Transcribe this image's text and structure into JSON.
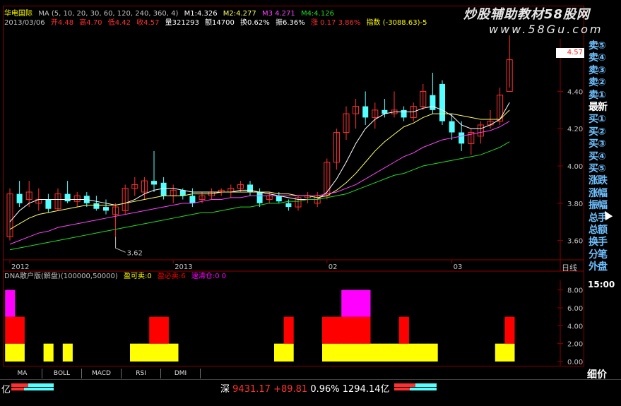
{
  "header": {
    "stock_name": "华电国际",
    "ma_label": "MA (5, 10, 20, 30, 60, 120, 240, 360, 4)",
    "m1": "M1:4.326",
    "m2": "M2:4.277",
    "m3": "M3 4.271",
    "m4": "M4:4.126",
    "date": "2013/03/06",
    "open": "开4.48",
    "high": "高4.70",
    "low": "低4.42",
    "close": "收4.57",
    "volume": "量321293",
    "amount": "额14700",
    "turnover": "换0.62%",
    "amplitude": "振6.36%",
    "change": "涨 0.17 3.86%",
    "index": "指数 (-3088.63)-5"
  },
  "watermark": {
    "line1": "炒股辅助教材58股网",
    "line2": "www.58Gu.com"
  },
  "chart_data": [
    {
      "type": "candlestick",
      "ylim": [
        3.5,
        4.72
      ],
      "y_ticks": [
        3.6,
        3.8,
        4.0,
        4.2,
        4.4
      ],
      "y_tick_labels": [
        "3.60",
        "3.80",
        "4.00",
        "4.20",
        "4.40"
      ],
      "x_tick_labels": [
        "2012",
        "2013",
        "02",
        "03"
      ],
      "x_tick_index": [
        0,
        17,
        33,
        46
      ],
      "grid": false,
      "current_price_label": "4.57",
      "low_annotation": {
        "label": "3.62",
        "index": 11,
        "value": 3.62
      },
      "candles": [
        {
          "o": 3.62,
          "h": 3.88,
          "l": 3.6,
          "c": 3.85
        },
        {
          "o": 3.85,
          "h": 3.92,
          "l": 3.78,
          "c": 3.8
        },
        {
          "o": 3.82,
          "h": 3.92,
          "l": 3.78,
          "c": 3.86
        },
        {
          "o": 3.8,
          "h": 3.88,
          "l": 3.76,
          "c": 3.82
        },
        {
          "o": 3.82,
          "h": 3.85,
          "l": 3.75,
          "c": 3.77
        },
        {
          "o": 3.77,
          "h": 3.88,
          "l": 3.76,
          "c": 3.85
        },
        {
          "o": 3.85,
          "h": 3.92,
          "l": 3.8,
          "c": 3.81
        },
        {
          "o": 3.81,
          "h": 3.86,
          "l": 3.78,
          "c": 3.84
        },
        {
          "o": 3.84,
          "h": 3.86,
          "l": 3.78,
          "c": 3.8
        },
        {
          "o": 3.8,
          "h": 3.84,
          "l": 3.76,
          "c": 3.77
        },
        {
          "o": 3.78,
          "h": 3.82,
          "l": 3.74,
          "c": 3.76
        },
        {
          "o": 3.74,
          "h": 3.8,
          "l": 3.62,
          "c": 3.78
        },
        {
          "o": 3.76,
          "h": 3.9,
          "l": 3.74,
          "c": 3.88
        },
        {
          "o": 3.88,
          "h": 3.94,
          "l": 3.84,
          "c": 3.9
        },
        {
          "o": 3.86,
          "h": 3.94,
          "l": 3.82,
          "c": 3.92
        },
        {
          "o": 3.92,
          "h": 4.08,
          "l": 3.86,
          "c": 3.9
        },
        {
          "o": 3.91,
          "h": 3.94,
          "l": 3.82,
          "c": 3.84
        },
        {
          "o": 3.84,
          "h": 3.9,
          "l": 3.8,
          "c": 3.87
        },
        {
          "o": 3.87,
          "h": 3.88,
          "l": 3.82,
          "c": 3.84
        },
        {
          "o": 3.84,
          "h": 3.88,
          "l": 3.78,
          "c": 3.8
        },
        {
          "o": 3.82,
          "h": 3.86,
          "l": 3.8,
          "c": 3.84
        },
        {
          "o": 3.84,
          "h": 3.88,
          "l": 3.82,
          "c": 3.86
        },
        {
          "o": 3.86,
          "h": 3.88,
          "l": 3.84,
          "c": 3.87
        },
        {
          "o": 3.86,
          "h": 3.9,
          "l": 3.83,
          "c": 3.88
        },
        {
          "o": 3.88,
          "h": 3.92,
          "l": 3.86,
          "c": 3.9
        },
        {
          "o": 3.9,
          "h": 3.92,
          "l": 3.84,
          "c": 3.86
        },
        {
          "o": 3.86,
          "h": 3.88,
          "l": 3.78,
          "c": 3.8
        },
        {
          "o": 3.82,
          "h": 3.86,
          "l": 3.8,
          "c": 3.84
        },
        {
          "o": 3.84,
          "h": 3.86,
          "l": 3.8,
          "c": 3.81
        },
        {
          "o": 3.8,
          "h": 3.82,
          "l": 3.76,
          "c": 3.78
        },
        {
          "o": 3.78,
          "h": 3.84,
          "l": 3.76,
          "c": 3.83
        },
        {
          "o": 3.83,
          "h": 3.86,
          "l": 3.8,
          "c": 3.84
        },
        {
          "o": 3.8,
          "h": 3.86,
          "l": 3.78,
          "c": 3.84
        },
        {
          "o": 3.84,
          "h": 4.04,
          "l": 3.82,
          "c": 4.02
        },
        {
          "o": 4.02,
          "h": 4.2,
          "l": 3.98,
          "c": 4.18
        },
        {
          "o": 4.18,
          "h": 4.32,
          "l": 4.14,
          "c": 4.28
        },
        {
          "o": 4.28,
          "h": 4.36,
          "l": 4.2,
          "c": 4.32
        },
        {
          "o": 4.32,
          "h": 4.4,
          "l": 4.22,
          "c": 4.26
        },
        {
          "o": 4.26,
          "h": 4.34,
          "l": 4.2,
          "c": 4.3
        },
        {
          "o": 4.3,
          "h": 4.36,
          "l": 4.26,
          "c": 4.28
        },
        {
          "o": 4.28,
          "h": 4.4,
          "l": 4.26,
          "c": 4.3
        },
        {
          "o": 4.3,
          "h": 4.32,
          "l": 4.24,
          "c": 4.26
        },
        {
          "o": 4.26,
          "h": 4.34,
          "l": 4.24,
          "c": 4.32
        },
        {
          "o": 4.32,
          "h": 4.44,
          "l": 4.3,
          "c": 4.4
        },
        {
          "o": 4.38,
          "h": 4.5,
          "l": 4.28,
          "c": 4.3
        },
        {
          "o": 4.44,
          "h": 4.46,
          "l": 4.22,
          "c": 4.24
        },
        {
          "o": 4.24,
          "h": 4.28,
          "l": 4.14,
          "c": 4.18
        },
        {
          "o": 4.18,
          "h": 4.24,
          "l": 4.08,
          "c": 4.12
        },
        {
          "o": 4.12,
          "h": 4.2,
          "l": 4.06,
          "c": 4.18
        },
        {
          "o": 4.16,
          "h": 4.24,
          "l": 4.12,
          "c": 4.22
        },
        {
          "o": 4.22,
          "h": 4.3,
          "l": 4.2,
          "c": 4.24
        },
        {
          "o": 4.24,
          "h": 4.42,
          "l": 4.22,
          "c": 4.38
        },
        {
          "o": 4.4,
          "h": 4.7,
          "l": 4.42,
          "c": 4.57
        }
      ],
      "ma_lines": [
        {
          "color": "#ffffff",
          "values": [
            3.7,
            3.76,
            3.8,
            3.82,
            3.82,
            3.82,
            3.82,
            3.82,
            3.82,
            3.81,
            3.8,
            3.79,
            3.8,
            3.82,
            3.85,
            3.87,
            3.88,
            3.88,
            3.87,
            3.86,
            3.86,
            3.86,
            3.86,
            3.86,
            3.87,
            3.87,
            3.86,
            3.85,
            3.84,
            3.83,
            3.82,
            3.82,
            3.82,
            3.86,
            3.93,
            4.02,
            4.12,
            4.2,
            4.25,
            4.28,
            4.29,
            4.29,
            4.29,
            4.31,
            4.32,
            4.3,
            4.27,
            4.22,
            4.2,
            4.2,
            4.22,
            4.25,
            4.34
          ]
        },
        {
          "color": "#ffff66",
          "values": [
            3.66,
            3.69,
            3.72,
            3.74,
            3.75,
            3.76,
            3.77,
            3.78,
            3.79,
            3.79,
            3.79,
            3.79,
            3.8,
            3.81,
            3.82,
            3.83,
            3.84,
            3.84,
            3.84,
            3.85,
            3.85,
            3.85,
            3.86,
            3.86,
            3.86,
            3.86,
            3.86,
            3.86,
            3.85,
            3.85,
            3.84,
            3.84,
            3.83,
            3.84,
            3.87,
            3.91,
            3.96,
            4.02,
            4.08,
            4.13,
            4.17,
            4.21,
            4.23,
            4.26,
            4.28,
            4.28,
            4.28,
            4.27,
            4.26,
            4.25,
            4.25,
            4.25,
            4.3
          ]
        },
        {
          "color": "#ff44ff",
          "values": [
            3.58,
            3.6,
            3.62,
            3.64,
            3.65,
            3.67,
            3.68,
            3.69,
            3.7,
            3.71,
            3.72,
            3.73,
            3.74,
            3.75,
            3.76,
            3.77,
            3.78,
            3.79,
            3.8,
            3.8,
            3.81,
            3.82,
            3.82,
            3.83,
            3.83,
            3.84,
            3.84,
            3.84,
            3.84,
            3.84,
            3.84,
            3.84,
            3.84,
            3.85,
            3.86,
            3.88,
            3.9,
            3.93,
            3.96,
            3.99,
            4.02,
            4.05,
            4.07,
            4.1,
            4.12,
            4.14,
            4.15,
            4.16,
            4.17,
            4.18,
            4.19,
            4.21,
            4.24
          ]
        },
        {
          "color": "#22dd22",
          "values": [
            3.55,
            3.56,
            3.57,
            3.58,
            3.59,
            3.6,
            3.61,
            3.62,
            3.63,
            3.64,
            3.65,
            3.66,
            3.67,
            3.68,
            3.69,
            3.7,
            3.71,
            3.72,
            3.73,
            3.74,
            3.75,
            3.75,
            3.76,
            3.77,
            3.78,
            3.78,
            3.79,
            3.8,
            3.8,
            3.81,
            3.81,
            3.82,
            3.82,
            3.83,
            3.84,
            3.85,
            3.87,
            3.89,
            3.91,
            3.93,
            3.95,
            3.96,
            3.98,
            4.0,
            4.01,
            4.02,
            4.03,
            4.04,
            4.05,
            4.06,
            4.08,
            4.1,
            4.13
          ]
        }
      ]
    },
    {
      "type": "bar",
      "title": "DNA散户版(解盘)(100000,50000)",
      "legend": [
        {
          "name": "盈可卖:0",
          "color": "#ffff00"
        },
        {
          "name": "盈必卖:6",
          "color": "#ff0000"
        },
        {
          "name": "速清仓:0 0",
          "color": "#ff00ff"
        }
      ],
      "ylim": [
        0,
        9
      ],
      "y_ticks": [
        0,
        2,
        4,
        6,
        8
      ],
      "y_tick_labels": [
        "0.00",
        "2.00",
        "4.00",
        "6.00",
        "8.00"
      ],
      "series": [
        {
          "name": "盈可卖",
          "color": "#ffff00",
          "values": [
            2,
            2,
            0,
            0,
            2,
            0,
            2,
            0,
            0,
            0,
            0,
            0,
            0,
            2,
            2,
            2,
            2,
            2,
            0,
            0,
            0,
            0,
            0,
            0,
            0,
            0,
            0,
            0,
            2,
            2,
            0,
            0,
            0,
            2,
            2,
            2,
            2,
            2,
            2,
            2,
            2,
            2,
            2,
            2,
            2,
            0,
            0,
            0,
            0,
            0,
            0,
            2,
            2
          ]
        },
        {
          "name": "盈必卖",
          "color": "#ff0000",
          "values": [
            3,
            3,
            0,
            0,
            0,
            0,
            0,
            0,
            0,
            0,
            0,
            0,
            0,
            0,
            0,
            3,
            3,
            0,
            0,
            0,
            0,
            0,
            0,
            0,
            0,
            0,
            0,
            0,
            0,
            3,
            0,
            0,
            0,
            3,
            3,
            3,
            3,
            3,
            0,
            0,
            0,
            3,
            0,
            0,
            0,
            0,
            0,
            0,
            0,
            0,
            0,
            0,
            3
          ]
        },
        {
          "name": "速清仓",
          "color": "#ff00ff",
          "values": [
            3,
            0,
            0,
            0,
            0,
            0,
            0,
            0,
            0,
            0,
            0,
            0,
            0,
            0,
            0,
            0,
            0,
            0,
            0,
            0,
            0,
            0,
            0,
            0,
            0,
            0,
            0,
            0,
            0,
            0,
            0,
            0,
            0,
            0,
            0,
            3,
            3,
            3,
            0,
            0,
            0,
            0,
            0,
            0,
            0,
            0,
            0,
            0,
            0,
            0,
            0,
            0,
            0
          ]
        }
      ]
    }
  ],
  "right_panel": {
    "items": [
      "卖⑤",
      "卖④",
      "卖③",
      "卖②",
      "卖①",
      "最新",
      "买①",
      "买②",
      "买③",
      "买④",
      "买⑤",
      "涨跌",
      "涨幅",
      "振幅",
      "总手",
      "总额",
      "换手",
      "分笔",
      "外盘"
    ],
    "period": "日线",
    "time": "15:00",
    "detail": "细价"
  },
  "tabs": [
    "MA",
    "BOLL",
    "MACD",
    "RSI",
    "DMI"
  ],
  "status": {
    "left": "亿",
    "market": "深",
    "index_value": "9431.17",
    "change": "+89.81",
    "pct": "0.96%",
    "amount": "1294.14亿"
  },
  "colors": {
    "up": "#ff3030",
    "down": "#54ffff",
    "frame": "#8b0000"
  }
}
